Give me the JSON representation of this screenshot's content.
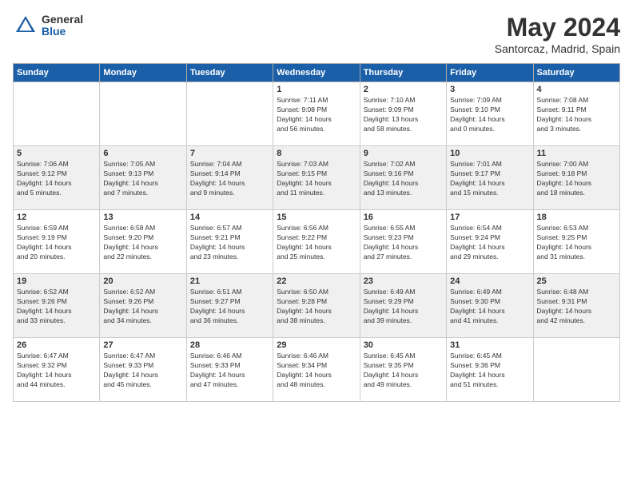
{
  "header": {
    "logo_general": "General",
    "logo_blue": "Blue",
    "month_title": "May 2024",
    "location": "Santorcaz, Madrid, Spain"
  },
  "weekdays": [
    "Sunday",
    "Monday",
    "Tuesday",
    "Wednesday",
    "Thursday",
    "Friday",
    "Saturday"
  ],
  "weeks": [
    {
      "alt": false,
      "days": [
        {
          "num": "",
          "info": ""
        },
        {
          "num": "",
          "info": ""
        },
        {
          "num": "",
          "info": ""
        },
        {
          "num": "1",
          "info": "Sunrise: 7:11 AM\nSunset: 9:08 PM\nDaylight: 14 hours\nand 56 minutes."
        },
        {
          "num": "2",
          "info": "Sunrise: 7:10 AM\nSunset: 9:09 PM\nDaylight: 13 hours\nand 58 minutes."
        },
        {
          "num": "3",
          "info": "Sunrise: 7:09 AM\nSunset: 9:10 PM\nDaylight: 14 hours\nand 0 minutes."
        },
        {
          "num": "4",
          "info": "Sunrise: 7:08 AM\nSunset: 9:11 PM\nDaylight: 14 hours\nand 3 minutes."
        }
      ]
    },
    {
      "alt": true,
      "days": [
        {
          "num": "5",
          "info": "Sunrise: 7:06 AM\nSunset: 9:12 PM\nDaylight: 14 hours\nand 5 minutes."
        },
        {
          "num": "6",
          "info": "Sunrise: 7:05 AM\nSunset: 9:13 PM\nDaylight: 14 hours\nand 7 minutes."
        },
        {
          "num": "7",
          "info": "Sunrise: 7:04 AM\nSunset: 9:14 PM\nDaylight: 14 hours\nand 9 minutes."
        },
        {
          "num": "8",
          "info": "Sunrise: 7:03 AM\nSunset: 9:15 PM\nDaylight: 14 hours\nand 11 minutes."
        },
        {
          "num": "9",
          "info": "Sunrise: 7:02 AM\nSunset: 9:16 PM\nDaylight: 14 hours\nand 13 minutes."
        },
        {
          "num": "10",
          "info": "Sunrise: 7:01 AM\nSunset: 9:17 PM\nDaylight: 14 hours\nand 15 minutes."
        },
        {
          "num": "11",
          "info": "Sunrise: 7:00 AM\nSunset: 9:18 PM\nDaylight: 14 hours\nand 18 minutes."
        }
      ]
    },
    {
      "alt": false,
      "days": [
        {
          "num": "12",
          "info": "Sunrise: 6:59 AM\nSunset: 9:19 PM\nDaylight: 14 hours\nand 20 minutes."
        },
        {
          "num": "13",
          "info": "Sunrise: 6:58 AM\nSunset: 9:20 PM\nDaylight: 14 hours\nand 22 minutes."
        },
        {
          "num": "14",
          "info": "Sunrise: 6:57 AM\nSunset: 9:21 PM\nDaylight: 14 hours\nand 23 minutes."
        },
        {
          "num": "15",
          "info": "Sunrise: 6:56 AM\nSunset: 9:22 PM\nDaylight: 14 hours\nand 25 minutes."
        },
        {
          "num": "16",
          "info": "Sunrise: 6:55 AM\nSunset: 9:23 PM\nDaylight: 14 hours\nand 27 minutes."
        },
        {
          "num": "17",
          "info": "Sunrise: 6:54 AM\nSunset: 9:24 PM\nDaylight: 14 hours\nand 29 minutes."
        },
        {
          "num": "18",
          "info": "Sunrise: 6:53 AM\nSunset: 9:25 PM\nDaylight: 14 hours\nand 31 minutes."
        }
      ]
    },
    {
      "alt": true,
      "days": [
        {
          "num": "19",
          "info": "Sunrise: 6:52 AM\nSunset: 9:26 PM\nDaylight: 14 hours\nand 33 minutes."
        },
        {
          "num": "20",
          "info": "Sunrise: 6:52 AM\nSunset: 9:26 PM\nDaylight: 14 hours\nand 34 minutes."
        },
        {
          "num": "21",
          "info": "Sunrise: 6:51 AM\nSunset: 9:27 PM\nDaylight: 14 hours\nand 36 minutes."
        },
        {
          "num": "22",
          "info": "Sunrise: 6:50 AM\nSunset: 9:28 PM\nDaylight: 14 hours\nand 38 minutes."
        },
        {
          "num": "23",
          "info": "Sunrise: 6:49 AM\nSunset: 9:29 PM\nDaylight: 14 hours\nand 39 minutes."
        },
        {
          "num": "24",
          "info": "Sunrise: 6:49 AM\nSunset: 9:30 PM\nDaylight: 14 hours\nand 41 minutes."
        },
        {
          "num": "25",
          "info": "Sunrise: 6:48 AM\nSunset: 9:31 PM\nDaylight: 14 hours\nand 42 minutes."
        }
      ]
    },
    {
      "alt": false,
      "days": [
        {
          "num": "26",
          "info": "Sunrise: 6:47 AM\nSunset: 9:32 PM\nDaylight: 14 hours\nand 44 minutes."
        },
        {
          "num": "27",
          "info": "Sunrise: 6:47 AM\nSunset: 9:33 PM\nDaylight: 14 hours\nand 45 minutes."
        },
        {
          "num": "28",
          "info": "Sunrise: 6:46 AM\nSunset: 9:33 PM\nDaylight: 14 hours\nand 47 minutes."
        },
        {
          "num": "29",
          "info": "Sunrise: 6:46 AM\nSunset: 9:34 PM\nDaylight: 14 hours\nand 48 minutes."
        },
        {
          "num": "30",
          "info": "Sunrise: 6:45 AM\nSunset: 9:35 PM\nDaylight: 14 hours\nand 49 minutes."
        },
        {
          "num": "31",
          "info": "Sunrise: 6:45 AM\nSunset: 9:36 PM\nDaylight: 14 hours\nand 51 minutes."
        },
        {
          "num": "",
          "info": ""
        }
      ]
    }
  ]
}
